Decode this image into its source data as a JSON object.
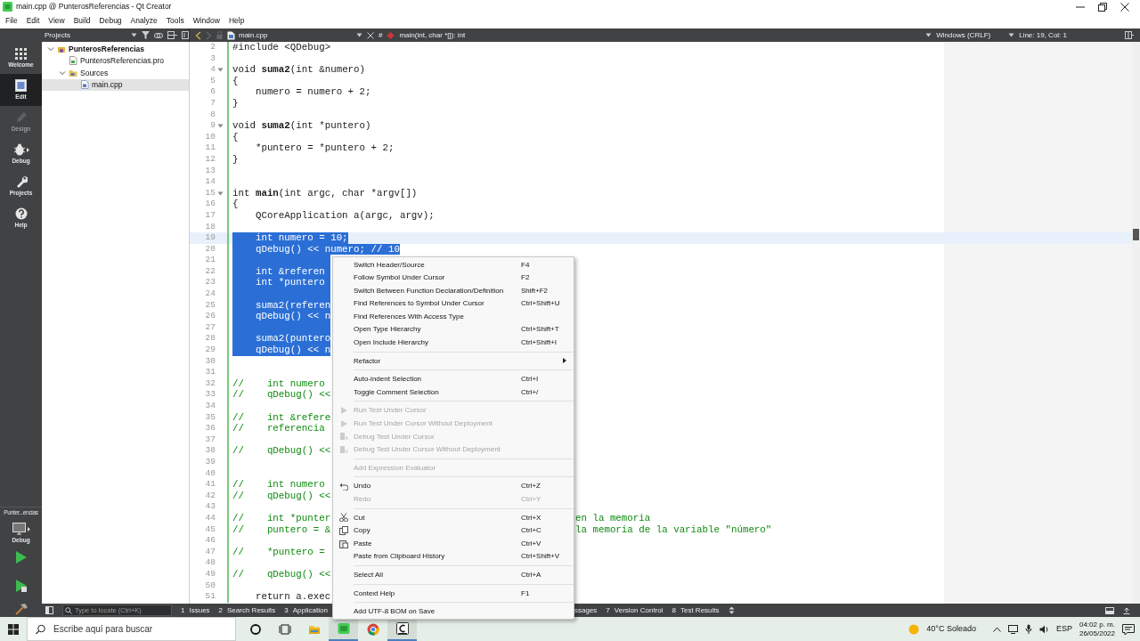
{
  "window": {
    "title": "main.cpp @ PunterosReferencias - Qt Creator"
  },
  "menu_bar": [
    "File",
    "Edit",
    "View",
    "Build",
    "Debug",
    "Analyze",
    "Tools",
    "Window",
    "Help"
  ],
  "mode_bar": {
    "items": [
      {
        "label": "Welcome",
        "kind": "welcome",
        "selected": false,
        "disabled": false
      },
      {
        "label": "Edit",
        "kind": "edit",
        "selected": true,
        "disabled": false
      },
      {
        "label": "Design",
        "kind": "design",
        "selected": false,
        "disabled": true
      },
      {
        "label": "Debug",
        "kind": "debug",
        "selected": false,
        "disabled": false
      },
      {
        "label": "Projects",
        "kind": "projects",
        "selected": false,
        "disabled": false
      },
      {
        "label": "Help",
        "kind": "help",
        "selected": false,
        "disabled": false
      }
    ],
    "kit": {
      "project": "Punter...encias",
      "label": "Debug"
    }
  },
  "projects_pane": {
    "title": "Projects",
    "tree": [
      {
        "label": "PunterosReferencias",
        "kind": "project",
        "expanded": true,
        "selected": false,
        "children": [
          {
            "label": "PunterosReferencias.pro",
            "kind": "pro",
            "selected": false
          },
          {
            "label": "Sources",
            "kind": "folder",
            "expanded": true,
            "selected": false,
            "children": [
              {
                "label": "main.cpp",
                "kind": "cpp",
                "selected": true
              }
            ]
          }
        ]
      }
    ]
  },
  "editor": {
    "file": "main.cpp",
    "hash": "#",
    "symbol": "main(int, char *[]): int",
    "line_ending": "Windows (CRLF)",
    "position": "Line: 19, Col: 1",
    "lines": [
      {
        "number": "2",
        "text": "#include <QDebug>",
        "kind": "code",
        "fold": false,
        "selected": false,
        "current": false
      },
      {
        "number": "3",
        "fold": false,
        "selected": false,
        "current": false
      },
      {
        "number": "4",
        "text": "void **suma2**(int &numero)",
        "kind": "code",
        "fold": true,
        "selected": false,
        "current": false
      },
      {
        "number": "5",
        "text": "{",
        "kind": "code",
        "fold": false,
        "selected": false,
        "current": false
      },
      {
        "number": "6",
        "text": "    numero = numero + 2;",
        "kind": "code",
        "fold": false,
        "selected": false,
        "current": false
      },
      {
        "number": "7",
        "text": "}",
        "kind": "code",
        "fold": false,
        "selected": false,
        "current": false
      },
      {
        "number": "8",
        "fold": false,
        "selected": false,
        "current": false
      },
      {
        "number": "9",
        "text": "void **suma2**(int *puntero)",
        "kind": "code",
        "fold": true,
        "selected": false,
        "current": false
      },
      {
        "number": "10",
        "text": "{",
        "kind": "code",
        "fold": false,
        "selected": false,
        "current": false
      },
      {
        "number": "11",
        "text": "    *puntero = *puntero + 2;",
        "kind": "code",
        "fold": false,
        "selected": false,
        "current": false
      },
      {
        "number": "12",
        "text": "}",
        "kind": "code",
        "fold": false,
        "selected": false,
        "current": false
      },
      {
        "number": "13",
        "fold": false,
        "selected": false,
        "current": false
      },
      {
        "number": "14",
        "fold": false,
        "selected": false,
        "current": false
      },
      {
        "number": "15",
        "text": "int **main**(int argc, char *argv[])",
        "kind": "code",
        "fold": true,
        "selected": false,
        "current": false
      },
      {
        "number": "16",
        "text": "{",
        "kind": "code",
        "fold": false,
        "selected": false,
        "current": false
      },
      {
        "number": "17",
        "text": "    QCoreApplication a(argc, argv);",
        "kind": "code",
        "fold": false,
        "selected": false,
        "current": false
      },
      {
        "number": "18",
        "fold": false,
        "selected": false,
        "current": false
      },
      {
        "number": "19",
        "text": "    int numero = 10;",
        "kind": "code",
        "fold": false,
        "selected": true,
        "current": true
      },
      {
        "number": "20",
        "text": "    qDebug() << numero; // 10",
        "kind": "code",
        "fold": false,
        "selected": true,
        "current": false
      },
      {
        "number": "21",
        "fold": false,
        "selected": true,
        "current": false
      },
      {
        "number": "22",
        "text": "    int &referen",
        "kind": "code",
        "fold": false,
        "selected": true,
        "current": false
      },
      {
        "number": "23",
        "text": "    int *puntero",
        "kind": "code",
        "fold": false,
        "selected": true,
        "current": false
      },
      {
        "number": "24",
        "fold": false,
        "selected": true,
        "current": false
      },
      {
        "number": "25",
        "text": "    suma2(referen",
        "kind": "code",
        "fold": false,
        "selected": true,
        "current": false
      },
      {
        "number": "26",
        "text": "    qDebug() << n",
        "kind": "code",
        "fold": false,
        "selected": true,
        "current": false
      },
      {
        "number": "27",
        "fold": false,
        "selected": true,
        "current": false
      },
      {
        "number": "28",
        "text": "    suma2(puntero",
        "kind": "code",
        "fold": false,
        "selected": true,
        "current": false
      },
      {
        "number": "29",
        "text": "    qDebug() << n",
        "kind": "code",
        "fold": false,
        "selected": true,
        "current": false
      },
      {
        "number": "30",
        "fold": false,
        "selected": false,
        "current": false
      },
      {
        "number": "31",
        "fold": false,
        "selected": false,
        "current": false
      },
      {
        "number": "32",
        "text": "//    int numero",
        "kind": "comment",
        "fold": false,
        "selected": false,
        "current": false
      },
      {
        "number": "33",
        "text": "//    qDebug() <<",
        "kind": "comment",
        "fold": false,
        "selected": false,
        "current": false
      },
      {
        "number": "34",
        "fold": false,
        "selected": false,
        "current": false
      },
      {
        "number": "35",
        "text": "//    int &refere",
        "kind": "comment",
        "fold": false,
        "selected": false,
        "current": false
      },
      {
        "number": "36",
        "text": "//    referencia",
        "kind": "comment",
        "fold": false,
        "selected": false,
        "current": false
      },
      {
        "number": "37",
        "fold": false,
        "selected": false,
        "current": false
      },
      {
        "number": "38",
        "text": "//    qDebug() <<",
        "kind": "comment",
        "fold": false,
        "selected": false,
        "current": false
      },
      {
        "number": "39",
        "fold": false,
        "selected": false,
        "current": false
      },
      {
        "number": "40",
        "fold": false,
        "selected": false,
        "current": false
      },
      {
        "number": "41",
        "text": "//    int numero",
        "kind": "comment",
        "fold": false,
        "selected": false,
        "current": false
      },
      {
        "number": "42",
        "text": "//    qDebug() <<",
        "kind": "comment",
        "fold": false,
        "selected": false,
        "current": false
      },
      {
        "number": "43",
        "fold": false,
        "selected": false,
        "current": false
      },
      {
        "number": "44",
        "text": "//    int *punter",
        "tail": "en la memoria",
        "kind": "comment",
        "fold": false,
        "selected": false,
        "current": false
      },
      {
        "number": "45",
        "text": "//    puntero = &",
        "tail": "la memoria de la variable \"número\"",
        "kind": "comment",
        "fold": false,
        "selected": false,
        "current": false
      },
      {
        "number": "46",
        "fold": false,
        "selected": false,
        "current": false
      },
      {
        "number": "47",
        "text": "//    *puntero =",
        "kind": "comment",
        "fold": false,
        "selected": false,
        "current": false
      },
      {
        "number": "48",
        "fold": false,
        "selected": false,
        "current": false
      },
      {
        "number": "49",
        "text": "//    qDebug() <<",
        "kind": "comment",
        "fold": false,
        "selected": false,
        "current": false
      },
      {
        "number": "50",
        "fold": false,
        "selected": false,
        "current": false
      },
      {
        "number": "51",
        "text": "    return a.exec",
        "kind": "code",
        "fold": false,
        "selected": false,
        "current": false
      }
    ]
  },
  "context_menu": [
    {
      "label": "Switch Header/Source",
      "shortcut": "F4",
      "kind": "item",
      "disabled": false
    },
    {
      "label": "Follow Symbol Under Cursor",
      "shortcut": "F2",
      "kind": "item",
      "disabled": false
    },
    {
      "label": "Switch Between Function Declaration/Definition",
      "shortcut": "Shift+F2",
      "kind": "item",
      "disabled": false
    },
    {
      "label": "Find References to Symbol Under Cursor",
      "shortcut": "Ctrl+Shift+U",
      "kind": "item",
      "disabled": false
    },
    {
      "label": "Find References With Access Type",
      "kind": "item",
      "disabled": false
    },
    {
      "label": "Open Type Hierarchy",
      "shortcut": "Ctrl+Shift+T",
      "kind": "item",
      "disabled": false
    },
    {
      "label": "Open Include Hierarchy",
      "shortcut": "Ctrl+Shift+I",
      "kind": "item",
      "disabled": false
    },
    {
      "kind": "separator"
    },
    {
      "label": "Refactor",
      "kind": "submenu",
      "disabled": false
    },
    {
      "kind": "separator"
    },
    {
      "label": "Auto-indent Selection",
      "shortcut": "Ctrl+I",
      "kind": "item",
      "disabled": false
    },
    {
      "label": "Toggle Comment Selection",
      "shortcut": "Ctrl+/",
      "kind": "item",
      "disabled": false
    },
    {
      "kind": "separator"
    },
    {
      "label": "Run Test Under Cursor",
      "kind": "run",
      "disabled": true
    },
    {
      "label": "Run Test Under Cursor Without Deployment",
      "kind": "run",
      "disabled": true
    },
    {
      "label": "Debug Test Under Cursor",
      "kind": "debugtest",
      "disabled": true
    },
    {
      "label": "Debug Test Under Cursor Without Deployment",
      "kind": "debugtest",
      "disabled": true
    },
    {
      "kind": "separator"
    },
    {
      "label": "Add Expression Evaluator",
      "kind": "item",
      "disabled": true
    },
    {
      "kind": "separator"
    },
    {
      "label": "Undo",
      "shortcut": "Ctrl+Z",
      "kind": "undo",
      "disabled": false
    },
    {
      "label": "Redo",
      "shortcut": "Ctrl+Y",
      "kind": "item",
      "disabled": true
    },
    {
      "kind": "separator"
    },
    {
      "label": "Cut",
      "shortcut": "Ctrl+X",
      "kind": "cut",
      "disabled": false
    },
    {
      "label": "Copy",
      "shortcut": "Ctrl+C",
      "kind": "copy",
      "disabled": false
    },
    {
      "label": "Paste",
      "shortcut": "Ctrl+V",
      "kind": "paste",
      "disabled": false
    },
    {
      "label": "Paste from Clipboard History",
      "shortcut": "Ctrl+Shift+V",
      "kind": "item",
      "disabled": false
    },
    {
      "kind": "separator"
    },
    {
      "label": "Select All",
      "shortcut": "Ctrl+A",
      "kind": "item",
      "disabled": false
    },
    {
      "kind": "separator"
    },
    {
      "label": "Context Help",
      "shortcut": "F1",
      "kind": "item",
      "disabled": false
    },
    {
      "kind": "separator"
    },
    {
      "label": "Add UTF-8 BOM on Save",
      "kind": "item",
      "disabled": false
    }
  ],
  "output_bar": {
    "locate_placeholder": "Type to locate (Ctrl+K)",
    "tabs": [
      {
        "number": "1",
        "label": "Issues"
      },
      {
        "number": "2",
        "label": "Search Results"
      },
      {
        "number": "3",
        "label": "Application"
      }
    ],
    "tabs_after_menu": [
      {
        "label": "ssages"
      },
      {
        "number": "7",
        "label": "Version Control"
      },
      {
        "number": "8",
        "label": "Test Results"
      }
    ]
  },
  "taskbar": {
    "search_placeholder": "Escribe aquí para buscar",
    "apps": [
      {
        "kind": "cortana",
        "active": false
      },
      {
        "kind": "taskview",
        "active": false
      },
      {
        "kind": "explorer",
        "active": false
      },
      {
        "kind": "qt",
        "active": true
      },
      {
        "kind": "browser",
        "active": false
      },
      {
        "kind": "terminal",
        "active": true
      }
    ],
    "weather": "40°C Soleado",
    "language": "ESP",
    "time": "04:02 p. m.",
    "date": "26/05/2022"
  }
}
